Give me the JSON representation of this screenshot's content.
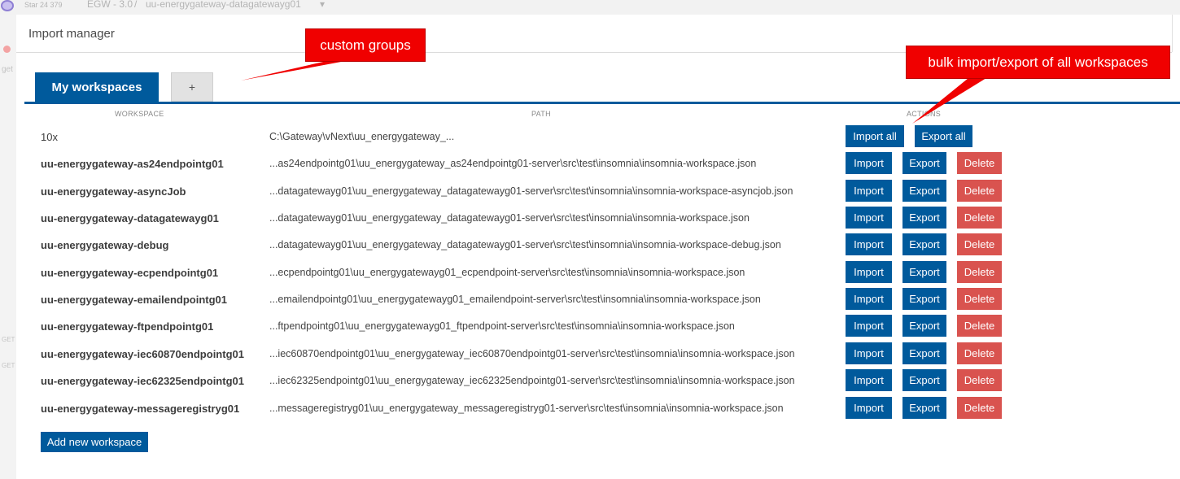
{
  "background_app": {
    "star_label": "Star",
    "star_count": "24 379",
    "project": "EGW - 3.0",
    "workspace": "uu-energygateway-datagatewayg01",
    "sidebar_fragments": [
      "get",
      "GET",
      "GET"
    ]
  },
  "modal": {
    "title": "Import manager",
    "tabs": [
      {
        "label": "My workspaces",
        "active": true
      },
      {
        "label": "+",
        "active": false
      }
    ],
    "columns": {
      "workspace": "WORKSPACE",
      "path": "PATH",
      "actions": "ACTIONS"
    },
    "group_row": {
      "name": "10x",
      "path": "C:\\Gateway\\vNext\\uu_energygateway_...",
      "import_all_label": "Import all",
      "export_all_label": "Export all"
    },
    "action_labels": {
      "import": "Import",
      "export": "Export",
      "delete": "Delete"
    },
    "workspaces": [
      {
        "name": "uu-energygateway-as24endpointg01",
        "path": "...as24endpointg01\\uu_energygateway_as24endpointg01-server\\src\\test\\insomnia\\insomnia-workspace.json"
      },
      {
        "name": "uu-energygateway-asyncJob",
        "path": "...datagatewayg01\\uu_energygateway_datagatewayg01-server\\src\\test\\insomnia\\insomnia-workspace-asyncjob.json"
      },
      {
        "name": "uu-energygateway-datagatewayg01",
        "path": "...datagatewayg01\\uu_energygateway_datagatewayg01-server\\src\\test\\insomnia\\insomnia-workspace.json"
      },
      {
        "name": "uu-energygateway-debug",
        "path": "...datagatewayg01\\uu_energygateway_datagatewayg01-server\\src\\test\\insomnia\\insomnia-workspace-debug.json"
      },
      {
        "name": "uu-energygateway-ecpendpointg01",
        "path": "...ecpendpointg01\\uu_energygatewayg01_ecpendpoint-server\\src\\test\\insomnia\\insomnia-workspace.json"
      },
      {
        "name": "uu-energygateway-emailendpointg01",
        "path": "...emailendpointg01\\uu_energygatewayg01_emailendpoint-server\\src\\test\\insomnia\\insomnia-workspace.json"
      },
      {
        "name": "uu-energygateway-ftpendpointg01",
        "path": "...ftpendpointg01\\uu_energygatewayg01_ftpendpoint-server\\src\\test\\insomnia\\insomnia-workspace.json"
      },
      {
        "name": "uu-energygateway-iec60870endpointg01",
        "path": "...iec60870endpointg01\\uu_energygateway_iec60870endpointg01-server\\src\\test\\insomnia\\insomnia-workspace.json"
      },
      {
        "name": "uu-energygateway-iec62325endpointg01",
        "path": "...iec62325endpointg01\\uu_energygateway_iec62325endpointg01-server\\src\\test\\insomnia\\insomnia-workspace.json"
      },
      {
        "name": "uu-energygateway-messageregistryg01",
        "path": "...messageregistryg01\\uu_energygateway_messageregistryg01-server\\src\\test\\insomnia\\insomnia-workspace.json"
      }
    ],
    "add_button_label": "Add new workspace"
  },
  "annotations": {
    "custom_groups": "custom groups",
    "bulk": "bulk import/export of all workspaces"
  },
  "colors": {
    "primary": "#005a9c",
    "danger": "#d9534f",
    "annotation": "#f00000"
  }
}
